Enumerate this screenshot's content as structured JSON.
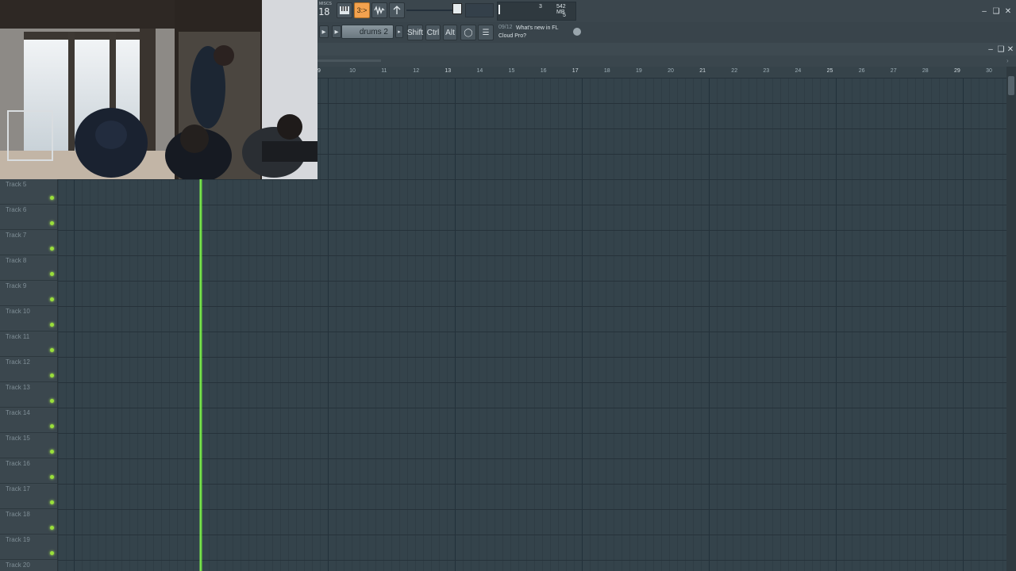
{
  "toolbar": {
    "tempo_label": "MISCS",
    "tempo_value": "18",
    "pattern_name": "drums 2",
    "modifier_keys": [
      "Shift",
      "Ctrl",
      "Alt"
    ],
    "cpu_value": "3",
    "poly_value": "5",
    "memory": "542 MB",
    "news_date": "09/12",
    "news_text": "What's new in FL Cloud Pro?"
  },
  "timeline": {
    "bars": [
      "9",
      "10",
      "11",
      "12",
      "13",
      "14",
      "15",
      "16",
      "17",
      "18",
      "19",
      "20",
      "21",
      "22",
      "23",
      "24",
      "25",
      "26",
      "27",
      "28",
      "29",
      "30"
    ]
  },
  "tracks": [
    "Track 5",
    "Track 6",
    "Track 7",
    "Track 8",
    "Track 9",
    "Track 10",
    "Track 11",
    "Track 12",
    "Track 13",
    "Track 14",
    "Track 15",
    "Track 16",
    "Track 17",
    "Track 18",
    "Track 19",
    "Track 20"
  ],
  "colors": {
    "accent": "#f3a24f",
    "playhead": "#8dff53",
    "background": "#34434b"
  }
}
